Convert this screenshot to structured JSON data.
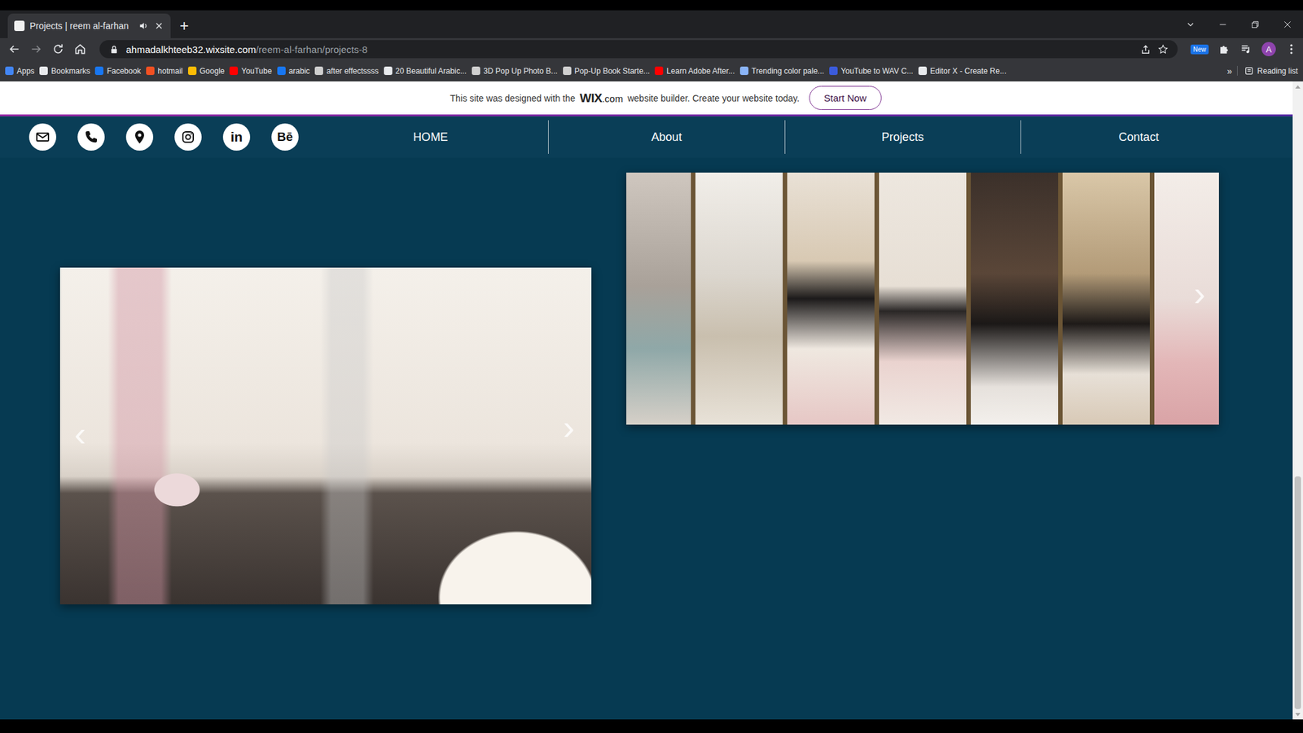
{
  "browser": {
    "tabs": [
      {
        "title": "Projects | reem al-farhan",
        "selected": true,
        "audio": true
      }
    ],
    "new_tab": "+",
    "url_host": "ahmadalkhteeb32.wixsite.com",
    "url_path": "/reem-al-farhan/projects-8",
    "extension_badge": "New",
    "profile": "A",
    "bookmarks": [
      {
        "label": "Apps",
        "color": "#4285f4"
      },
      {
        "label": "Bookmarks",
        "color": "#e8eaed"
      },
      {
        "label": "Facebook",
        "color": "#1877f2"
      },
      {
        "label": "hotmail",
        "color": "#f25022"
      },
      {
        "label": "Google",
        "color": "#fbbc05"
      },
      {
        "label": "YouTube",
        "color": "#ff0000"
      },
      {
        "label": "arabic",
        "color": "#1877f2"
      },
      {
        "label": "after effectssss",
        "color": "#cfcfcf"
      },
      {
        "label": "20 Beautiful Arabic...",
        "color": "#e8eaed"
      },
      {
        "label": "3D Pop Up Photo B...",
        "color": "#d0d0d0"
      },
      {
        "label": "Pop-Up Book Starte...",
        "color": "#d0d0d0"
      },
      {
        "label": "Learn Adobe After...",
        "color": "#ff0000"
      },
      {
        "label": "Trending color pale...",
        "color": "#8ab4f8"
      },
      {
        "label": "YouTube to WAV C...",
        "color": "#3b5bdb"
      },
      {
        "label": "Editor X - Create Re...",
        "color": "#e8eaed"
      }
    ],
    "bookmarks_more": "»",
    "reading_list": "Reading list"
  },
  "banner": {
    "text_before": "This site was designed with the",
    "logo": "WIX",
    "logo_suffix": ".com",
    "text_after": "website builder. Create your website today.",
    "button": "Start Now"
  },
  "nav": {
    "social": [
      {
        "kind": "mail"
      },
      {
        "kind": "phone"
      },
      {
        "kind": "location"
      },
      {
        "kind": "instagram"
      },
      {
        "kind": "linkedin",
        "label": "in"
      },
      {
        "kind": "behance",
        "label": "Bē"
      }
    ],
    "menu": [
      {
        "label": "HOME",
        "selected": false
      },
      {
        "label": "About",
        "selected": false
      },
      {
        "label": "Projects",
        "selected": false
      },
      {
        "label": "Contact",
        "selected": false
      }
    ]
  },
  "gallery": {
    "prev": "‹",
    "next": "›"
  },
  "strip": {
    "next": "›"
  },
  "scrollbar": {
    "level": 1
  }
}
